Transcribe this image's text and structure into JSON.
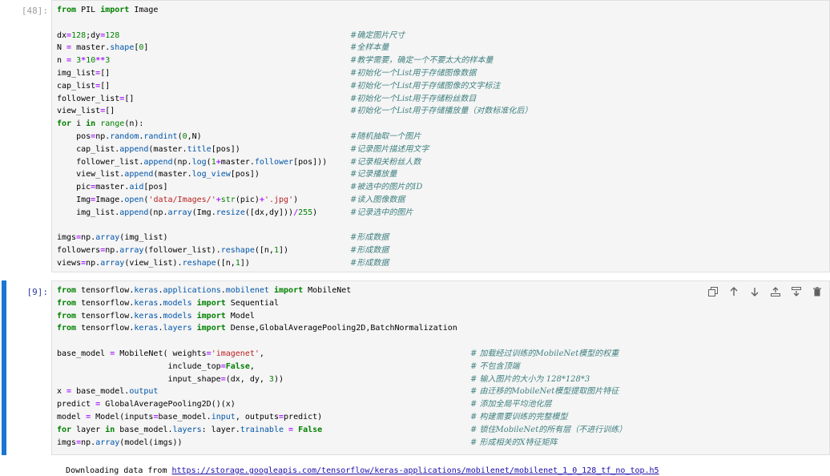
{
  "cell48": {
    "prompt": "[48]:",
    "lines": [
      {
        "code": "from PIL import Image",
        "comment": ""
      },
      {
        "code": "",
        "comment": ""
      },
      {
        "code": "dx=128;dy=128",
        "comment": "#确定图片尺寸"
      },
      {
        "code": "N = master.shape[0]",
        "comment": "#全样本量"
      },
      {
        "code": "n = 3*10**3",
        "comment": "#教学需要，确定一个不要太大的样本量"
      },
      {
        "code": "img_list=[]",
        "comment": "#初始化一个List用于存储图像数据"
      },
      {
        "code": "cap_list=[]",
        "comment": "#初始化一个List用于存储图像的文字标注"
      },
      {
        "code": "follower_list=[]",
        "comment": "#初始化一个List用于存储粉丝数目"
      },
      {
        "code": "view_list=[]",
        "comment": "#初始化一个List用于存储播放量（对数标准化后）"
      },
      {
        "code": "for i in range(n):",
        "comment": ""
      },
      {
        "code": "    pos=np.random.randint(0,N)",
        "comment": "#随机抽取一个图片"
      },
      {
        "code": "    cap_list.append(master.title[pos])",
        "comment": "#记录图片描述用文字"
      },
      {
        "code": "    follower_list.append(np.log(1+master.follower[pos]))",
        "comment": "#记录相关粉丝人数"
      },
      {
        "code": "    view_list.append(master.log_view[pos])",
        "comment": "#记录播放量"
      },
      {
        "code": "    pic=master.aid[pos]",
        "comment": "#被选中的图片的ID"
      },
      {
        "code": "    Img=Image.open('data/Images/'+str(pic)+'.jpg')",
        "comment": "#读入图像数据"
      },
      {
        "code": "    img_list.append(np.array(Img.resize([dx,dy]))/255)",
        "comment": "#记录选中的图片"
      },
      {
        "code": "",
        "comment": ""
      },
      {
        "code": "imgs=np.array(img_list)",
        "comment": "#形成数据"
      },
      {
        "code": "followers=np.array(follower_list).reshape([n,1])",
        "comment": "#形成数据"
      },
      {
        "code": "views=np.array(view_list).reshape([n,1])",
        "comment": "#形成数据"
      }
    ]
  },
  "cell9": {
    "prompt": "[9]:",
    "lines": [
      {
        "code": "from tensorflow.keras.applications.mobilenet import MobileNet",
        "comment": ""
      },
      {
        "code": "from tensorflow.keras.models import Sequential",
        "comment": ""
      },
      {
        "code": "from tensorflow.keras.models import Model",
        "comment": ""
      },
      {
        "code": "from tensorflow.keras.layers import Dense,GlobalAveragePooling2D,BatchNormalization",
        "comment": ""
      },
      {
        "code": "",
        "comment": ""
      },
      {
        "code": "base_model = MobileNet( weights='imagenet',",
        "comment": "# 加载经过训练的MobileNet模型的权重"
      },
      {
        "code": "                       include_top=False,",
        "comment": "# 不包含顶端"
      },
      {
        "code": "                       input_shape=(dx, dy, 3))",
        "comment": "# 输入图片的大小为 128*128*3"
      },
      {
        "code": "x = base_model.output",
        "comment": "# 由迁移的MobileNet模型提取图片特征"
      },
      {
        "code": "predict = GlobalAveragePooling2D()(x)",
        "comment": "# 添加全局平均池化层"
      },
      {
        "code": "model = Model(inputs=base_model.input, outputs=predict)",
        "comment": "# 构建需要训练的完整模型"
      },
      {
        "code": "for layer in base_model.layers: layer.trainable = False",
        "comment": "# 锁住MobileNet的所有层（不进行训练）"
      },
      {
        "code": "imgs=np.array(model(imgs))",
        "comment": "# 形成相关的X特征矩阵"
      }
    ]
  },
  "toolbar": {
    "icons": [
      "copy-icon",
      "move-up-icon",
      "move-down-icon",
      "insert-above-icon",
      "insert-below-icon",
      "delete-icon"
    ]
  },
  "output": {
    "prefix": "Downloading data from ",
    "url": "https://storage.googleapis.com/tensorflow/keras-applications/mobilenet/mobilenet_1_0_128_tf_no_top.h5"
  }
}
